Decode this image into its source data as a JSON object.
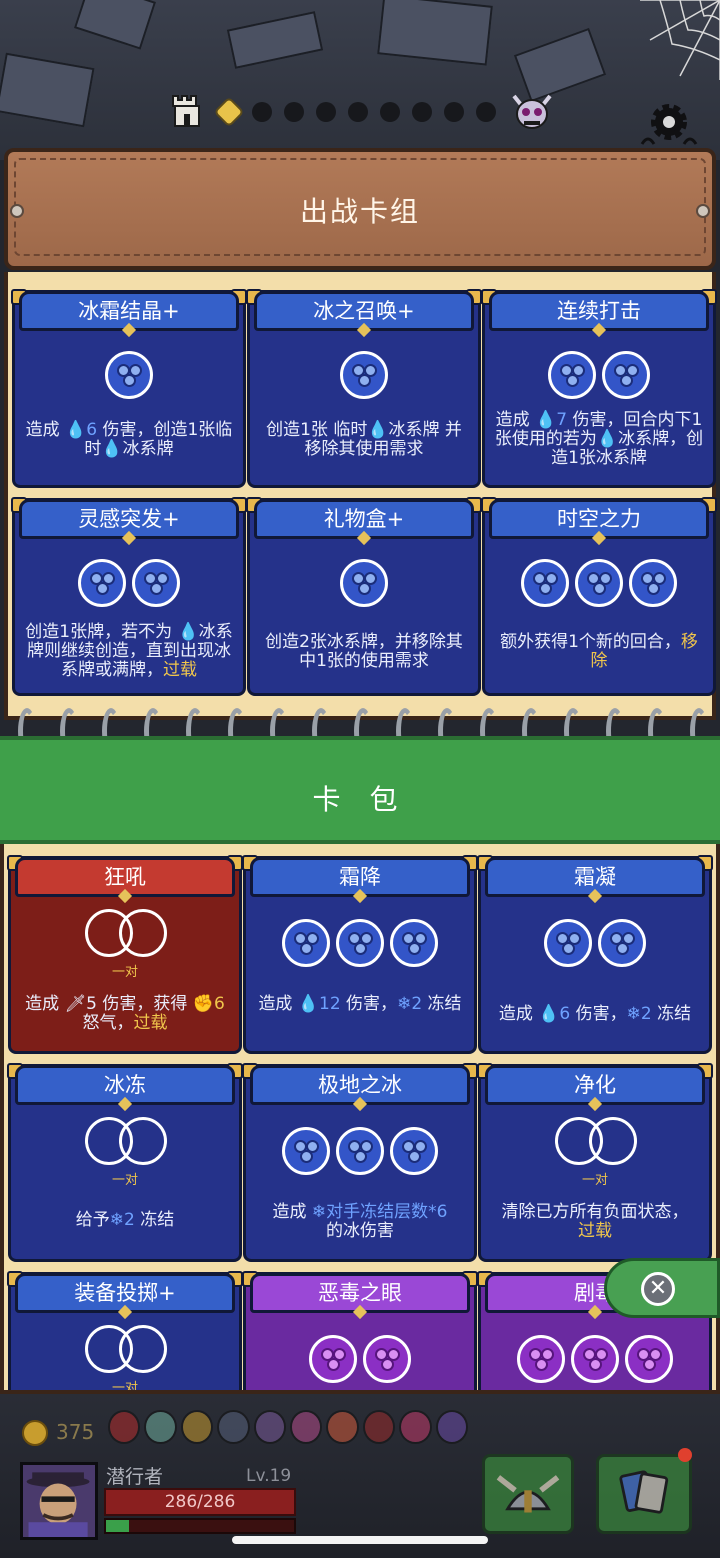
{
  "colors": {
    "accent_gold": "#f0c64c",
    "card_blue": "#25328a",
    "card_red": "#7d1e18",
    "card_purple": "#6a2aa0",
    "pack_green": "#3fa04a"
  },
  "map_progress": {
    "stage_icon": "castle-icon",
    "boss_icon": "demon-skull-icon",
    "current_node": 1,
    "total_nodes": 9
  },
  "deck": {
    "title": "出战卡组",
    "cards": [
      {
        "name": "冰霜结晶+",
        "cost": [
          "ice"
        ],
        "desc_parts": [
          "造成 ",
          "6",
          " 伤害，创造1张临时",
          "冰系牌"
        ]
      },
      {
        "name": "冰之召唤+",
        "cost": [
          "ice"
        ],
        "desc_parts": [
          "创造1张 临时",
          "冰系牌 并移除其使用需求"
        ]
      },
      {
        "name": "连续打击",
        "cost": [
          "ice",
          "ice"
        ],
        "desc_parts": [
          "造成 ",
          "7",
          " 伤害，回合内下1张使用的若为",
          "冰系牌，创造1张冰系牌"
        ]
      },
      {
        "name": "灵感突发+",
        "cost": [
          "ice",
          "ice"
        ],
        "desc_parts": [
          "创造1张牌，若不为 ",
          "冰系牌则继续创造，直到出现冰系牌或满牌，",
          "过载"
        ]
      },
      {
        "name": "礼物盒+",
        "cost": [
          "ice"
        ],
        "desc_parts": [
          "创造2张冰系牌，并移除其中1张的使用需求"
        ]
      },
      {
        "name": "时空之力",
        "cost": [
          "ice",
          "ice",
          "ice"
        ],
        "desc_parts": [
          "额外获得1个新的回合，",
          "移除"
        ]
      }
    ]
  },
  "pack": {
    "title": "卡 包",
    "pair_label": "一对",
    "cards": [
      {
        "name": "狂吼",
        "desc_parts": [
          "造成 ",
          "5",
          " 伤害，获得 ",
          "6",
          " 怒气，",
          "过载"
        ]
      },
      {
        "name": "霜降",
        "desc_parts": [
          "造成 ",
          "12",
          " 伤害，",
          "2",
          " 冻结"
        ]
      },
      {
        "name": "霜凝",
        "desc_parts": [
          "造成 ",
          "6",
          " 伤害，",
          "2",
          " 冻结"
        ]
      },
      {
        "name": "冰冻",
        "desc_parts": [
          "给予",
          "2",
          " 冻结"
        ]
      },
      {
        "name": "极地之冰",
        "desc_parts": [
          "造成 ",
          "对手冻结层数*6",
          "的冰伤害"
        ]
      },
      {
        "name": "净化",
        "desc_parts": [
          "清除已方所有负面状态，",
          "过载"
        ]
      },
      {
        "name": "装备投掷+",
        "desc_parts": []
      },
      {
        "name": "恶毒之眼",
        "desc_parts": []
      },
      {
        "name": "剧毒",
        "desc_parts": []
      }
    ]
  },
  "player": {
    "gold": "375",
    "name": "潜行者",
    "level": "Lv.19",
    "hp": "286/286",
    "xp_fraction": 0.12
  },
  "icons": {
    "settings": "gear-icon",
    "close": "close-icon",
    "equipment": "helmet-icon",
    "deck_view": "cards-icon"
  }
}
